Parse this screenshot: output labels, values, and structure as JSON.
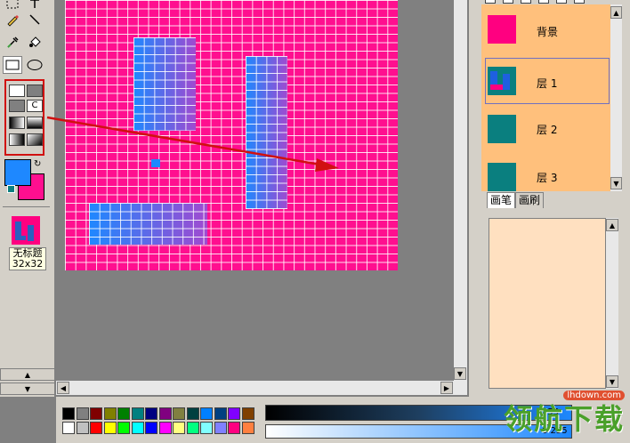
{
  "colors": {
    "foreground": "#1e88ff",
    "background": "#ff0f8f",
    "canvas_fill": "#ff0f8f",
    "layer_panel_bg": "#ffc07c",
    "teal": "#0a7f7f"
  },
  "toolbar": {
    "tools": [
      "select-icon",
      "line-icon",
      "pencil-icon",
      "bucket-icon",
      "eyedropper-icon",
      "rectangle-icon",
      "ellipse-icon"
    ],
    "swap_symbol": "↻"
  },
  "thumbnail": {
    "name": "无标题",
    "size": "32x32"
  },
  "layers": [
    {
      "name": "背景",
      "color": "#ff0080",
      "selected": false
    },
    {
      "name": "层 1",
      "color": "#0a7f7f",
      "selected": true
    },
    {
      "name": "层 2",
      "color": "#0a7f7f",
      "selected": false
    },
    {
      "name": "层 3",
      "color": "#0a7f7f",
      "selected": false
    }
  ],
  "tabs": [
    "画笔",
    "画刷"
  ],
  "palette": [
    "#000000",
    "#808080",
    "#800000",
    "#808000",
    "#008000",
    "#008080",
    "#000080",
    "#800080",
    "#808040",
    "#004040",
    "#0080ff",
    "#004080",
    "#8000ff",
    "#804000",
    "#ffffff",
    "#c0c0c0",
    "#ff0000",
    "#ffff00",
    "#00ff00",
    "#00ffff",
    "#0000ff",
    "#ff00ff",
    "#ffff80",
    "#00ff80",
    "#80ffff",
    "#8080ff",
    "#ff0080",
    "#ff8040"
  ],
  "bars": {
    "value_top": "255",
    "value_bottom": "0 255"
  },
  "watermark": {
    "text": "领航下载",
    "url": "lhdown.com"
  }
}
